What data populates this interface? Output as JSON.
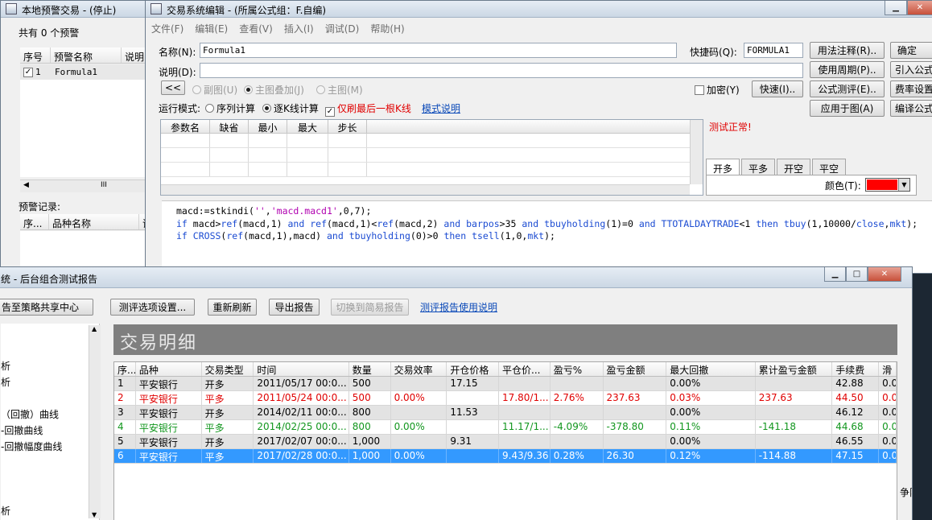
{
  "alert_window": {
    "title": "本地预警交易 - (停止)",
    "count_label": "共有 0 个预警",
    "columns": [
      "序号",
      "预警名称",
      "说明"
    ],
    "rows": [
      {
        "no": "1",
        "name": "Formula1",
        "checked": true
      }
    ],
    "records_label": "预警记录:",
    "record_columns": [
      "序...",
      "品种名称",
      "证"
    ],
    "scroll_glyph": "III"
  },
  "editor": {
    "title": "交易系统编辑 - (所属公式组：F.自编)",
    "menu": [
      "文件(F)",
      "编辑(E)",
      "查看(V)",
      "插入(I)",
      "调试(D)",
      "帮助(H)"
    ],
    "name_label": "名称(N):",
    "name_value": "Formula1",
    "shortcut_label": "快捷码(Q):",
    "shortcut_value": "FORMULA1",
    "desc_label": "说明(D):",
    "collapse_button": "<<",
    "chart_options": [
      "副图(U)",
      "主图叠加(J)",
      "主图(M)"
    ],
    "encrypt_label": "加密(Y)",
    "quick_button": "快速(I)..",
    "right_buttons": [
      "用法注释(R)..",
      "使用周期(P)..",
      "公式测评(E)..",
      "应用于图(A)"
    ],
    "far_buttons": [
      "确定",
      "引入公式",
      "费率设置",
      "编译公式"
    ],
    "run_mode_label": "运行模式:",
    "run_modes": [
      "序列计算",
      "逐K线计算"
    ],
    "refresh_last_label": "仅刷最后一根K线",
    "mode_help_link": "模式说明",
    "param_columns": [
      "参数名",
      "缺省",
      "最小",
      "最大",
      "步长"
    ],
    "test_status": "测试正常!",
    "tabs": [
      "开多",
      "平多",
      "开空",
      "平空"
    ],
    "color_label": "颜色(T):",
    "color_value": "#ff0000",
    "code_lines": [
      "macd:=stkindi('','macd.macd1',0,7);",
      "if macd>ref(macd,1) and ref(macd,1)<ref(macd,2) and barpos>35 and tbuyholding(1)=0 and TTOTALDAYTRADE<1 then tbuy(1,10000/close,mkt);",
      "if CROSS(ref(macd,1),macd) and tbuyholding(0)>0 then tsell(1,0,mkt);"
    ]
  },
  "report": {
    "title": "统 - 后台组合测试报告",
    "share_button": "告至策略共享中心",
    "buttons": [
      "测评选项设置...",
      "重新刷新",
      "导出报告",
      "切换到简易报告"
    ],
    "help_link": "测评报告使用说明",
    "banner": "交易明细",
    "left_items": [
      "析",
      "析",
      "（回撤）曲线",
      "-回撤曲线",
      "-回撤幅度曲线",
      "析"
    ],
    "columns": [
      "序...",
      "品种",
      "交易类型",
      "时间",
      "数量",
      "交易效率",
      "开仓价格",
      "平仓价...",
      "盈亏%",
      "盈亏金额",
      "最大回撤",
      "累计盈亏金额",
      "手续费",
      "滑"
    ],
    "rows": [
      {
        "style": "gray",
        "cells": [
          "1",
          "平安银行",
          "开多",
          "2011/05/17 00:0...",
          "500",
          "",
          "17.15",
          "",
          "",
          "",
          "0.00%",
          "",
          "42.88",
          "0.0"
        ]
      },
      {
        "style": "red",
        "cells": [
          "2",
          "平安银行",
          "平多",
          "2011/05/24 00:0...",
          "500",
          "0.00%",
          "",
          "17.80/1...",
          "2.76%",
          "237.63",
          "0.03%",
          "237.63",
          "44.50",
          "0.0"
        ]
      },
      {
        "style": "gray",
        "cells": [
          "3",
          "平安银行",
          "开多",
          "2014/02/11 00:0...",
          "800",
          "",
          "11.53",
          "",
          "",
          "",
          "0.00%",
          "",
          "46.12",
          "0.0"
        ]
      },
      {
        "style": "green",
        "cells": [
          "4",
          "平安银行",
          "平多",
          "2014/02/25 00:0...",
          "800",
          "0.00%",
          "",
          "11.17/1...",
          "-4.09%",
          "-378.80",
          "0.11%",
          "-141.18",
          "44.68",
          "0.0"
        ]
      },
      {
        "style": "gray",
        "cells": [
          "5",
          "平安银行",
          "开多",
          "2017/02/07 00:0...",
          "1,000",
          "",
          "9.31",
          "",
          "",
          "",
          "0.00%",
          "",
          "46.55",
          "0.0"
        ]
      },
      {
        "style": "sel",
        "cells": [
          "6",
          "平安银行",
          "平多",
          "2017/02/28 00:0...",
          "1,000",
          "0.00%",
          "",
          "9.43/9.36",
          "0.28%",
          "26.30",
          "0.12%",
          "-114.88",
          "47.15",
          "0.0"
        ]
      }
    ],
    "side_text": "争队列"
  }
}
